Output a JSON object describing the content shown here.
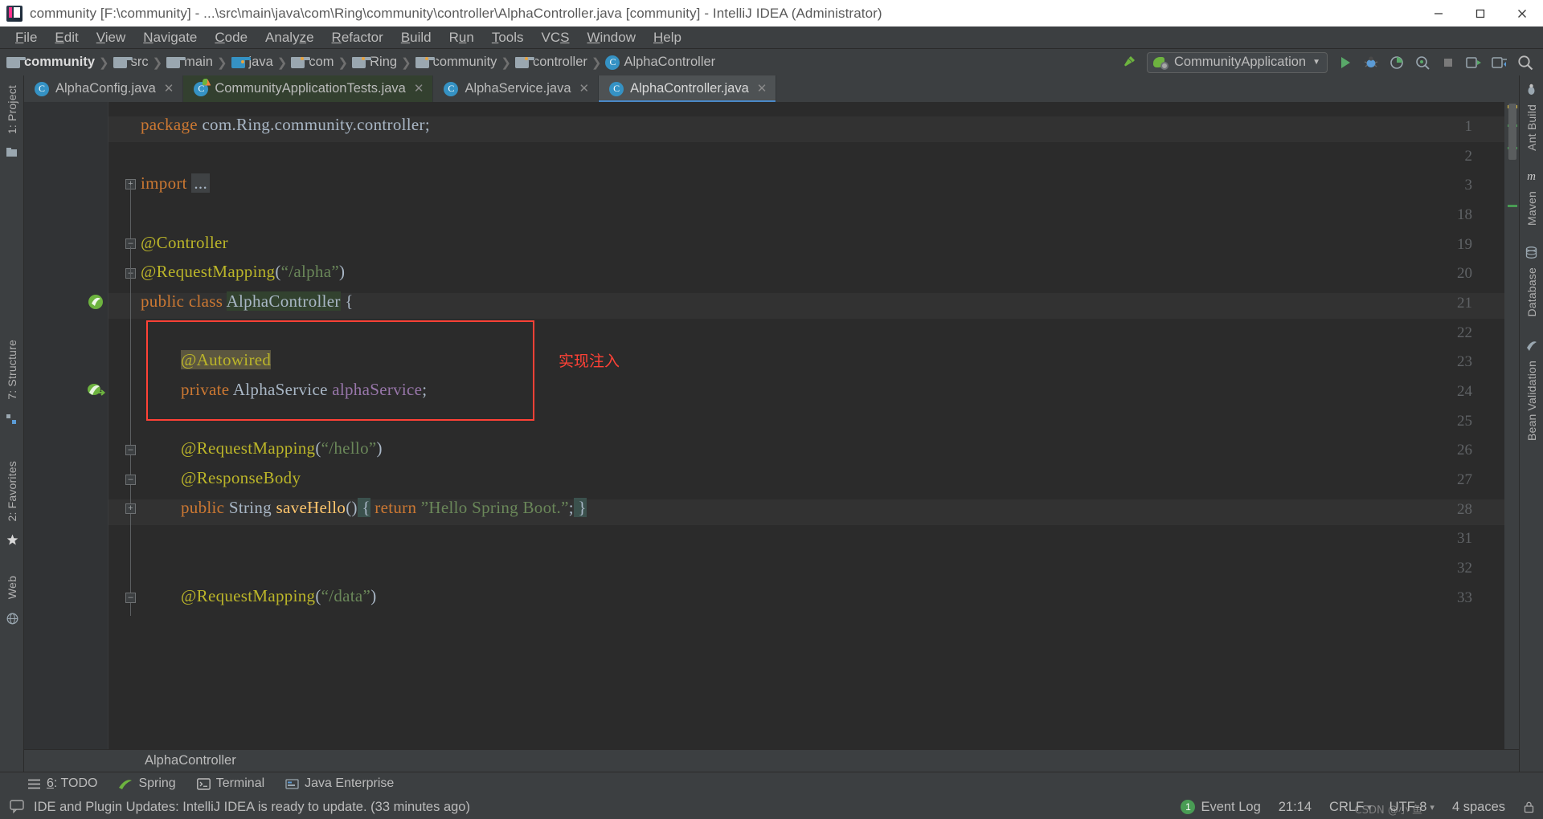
{
  "window": {
    "title": "community [F:\\community] - ...\\src\\main\\java\\com\\Ring\\community\\controller\\AlphaController.java [community] - IntelliJ IDEA (Administrator)",
    "app_icon": "intellij-idea-icon",
    "controls": {
      "minimize": "minimize-icon",
      "maximize": "maximize-icon",
      "close": "close-icon"
    }
  },
  "menu": [
    {
      "label": "File",
      "mnemonic": "F"
    },
    {
      "label": "Edit",
      "mnemonic": "E"
    },
    {
      "label": "View",
      "mnemonic": "V"
    },
    {
      "label": "Navigate",
      "mnemonic": "N"
    },
    {
      "label": "Code",
      "mnemonic": "C"
    },
    {
      "label": "Analyze",
      "mnemonic": "z"
    },
    {
      "label": "Refactor",
      "mnemonic": "R"
    },
    {
      "label": "Build",
      "mnemonic": "B"
    },
    {
      "label": "Run",
      "mnemonic": "u"
    },
    {
      "label": "Tools",
      "mnemonic": "T"
    },
    {
      "label": "VCS",
      "mnemonic": "S"
    },
    {
      "label": "Window",
      "mnemonic": "W"
    },
    {
      "label": "Help",
      "mnemonic": "H"
    }
  ],
  "breadcrumb": [
    {
      "label": "community",
      "icon": "folder-icon",
      "kind": "module",
      "bold": true
    },
    {
      "label": "src",
      "icon": "folder-icon",
      "kind": "folder"
    },
    {
      "label": "main",
      "icon": "folder-icon",
      "kind": "folder"
    },
    {
      "label": "java",
      "icon": "source-root-folder-icon",
      "kind": "source-root"
    },
    {
      "label": "com",
      "icon": "package-folder-icon",
      "kind": "package"
    },
    {
      "label": "Ring",
      "icon": "package-folder-icon",
      "kind": "package"
    },
    {
      "label": "community",
      "icon": "package-folder-icon",
      "kind": "package"
    },
    {
      "label": "controller",
      "icon": "package-folder-icon",
      "kind": "package"
    },
    {
      "label": "AlphaController",
      "icon": "java-class-icon",
      "kind": "class"
    }
  ],
  "toolbar": {
    "build_icon": "hammer-build-icon",
    "run_config": {
      "name": "CommunityApplication",
      "icon": "spring-boot-icon",
      "caret": "chevron-down-icon"
    },
    "buttons": [
      {
        "name": "run-button",
        "icon": "play-icon",
        "color": "#59a869"
      },
      {
        "name": "debug-button",
        "icon": "debug-bug-icon",
        "color": "#9aa7b0"
      },
      {
        "name": "run-with-coverage-button",
        "icon": "coverage-icon",
        "color": "#9aa7b0"
      },
      {
        "name": "profile-button",
        "icon": "profiler-icon",
        "color": "#9aa7b0"
      },
      {
        "name": "stop-button",
        "icon": "stop-square-icon",
        "color": "#8a8a8a"
      },
      {
        "name": "git-update-button",
        "icon": "update-project-icon",
        "color": "#9aa7b0"
      },
      {
        "name": "git-commit-button",
        "icon": "commit-icon",
        "color": "#9aa7b0"
      },
      {
        "name": "search-everywhere-button",
        "icon": "search-icon",
        "color": "#bbbbbb"
      }
    ]
  },
  "tabs": [
    {
      "label": "AlphaConfig.java",
      "icon": "java-class-icon",
      "active": false,
      "modified": false,
      "close": "close-icon"
    },
    {
      "label": "CommunityApplicationTests.java",
      "icon": "spring-boot-class-icon",
      "active": false,
      "modified": true,
      "close": "close-icon"
    },
    {
      "label": "AlphaService.java",
      "icon": "java-class-icon",
      "active": false,
      "modified": false,
      "close": "close-icon"
    },
    {
      "label": "AlphaController.java",
      "icon": "java-class-icon",
      "active": true,
      "modified": false,
      "close": "close-icon"
    }
  ],
  "editor": {
    "language": "java",
    "line_numbers": [
      1,
      2,
      3,
      18,
      19,
      20,
      21,
      22,
      23,
      24,
      25,
      26,
      27,
      28,
      31,
      32,
      33
    ],
    "gutter_icons": [
      {
        "line": 21,
        "name": "spring-bean-gutter-icon"
      },
      {
        "line": 24,
        "name": "spring-autowired-gutter-icon"
      }
    ],
    "fold_markers": [
      {
        "line": 3,
        "glyph": "+",
        "name": "expand-imports-fold-icon"
      },
      {
        "line": 19,
        "glyph": "-",
        "name": "collapse-class-fold-icon"
      },
      {
        "line": 20,
        "glyph": "-",
        "name": "collapse-fold-icon"
      },
      {
        "line": 26,
        "glyph": "-",
        "name": "collapse-method-fold-icon"
      },
      {
        "line": 27,
        "glyph": "-",
        "name": "collapse-fold-icon"
      },
      {
        "line": 28,
        "glyph": "+",
        "name": "expand-body-fold-icon"
      },
      {
        "line": 33,
        "glyph": "-",
        "name": "collapse-method-fold-icon"
      }
    ],
    "lines": [
      {
        "n": 1,
        "tokens": [
          {
            "t": "package",
            "c": "kw"
          },
          {
            "t": " com.Ring.community.controller;",
            "c": "plain"
          }
        ]
      },
      {
        "n": 2,
        "tokens": []
      },
      {
        "n": 3,
        "tokens": [
          {
            "t": "import",
            "c": "kw"
          },
          {
            "t": " ",
            "c": "plain"
          },
          {
            "t": "...",
            "c": "plain",
            "hl": "folded"
          }
        ]
      },
      {
        "n": 18,
        "tokens": []
      },
      {
        "n": 19,
        "tokens": [
          {
            "t": "@Controller",
            "c": "ann"
          }
        ]
      },
      {
        "n": 20,
        "tokens": [
          {
            "t": "@RequestMapping",
            "c": "ann"
          },
          {
            "t": "(",
            "c": "plain"
          },
          {
            "t": "\"/alpha\"",
            "c": "str"
          },
          {
            "t": ")",
            "c": "plain"
          }
        ]
      },
      {
        "n": 21,
        "tokens": [
          {
            "t": "public class ",
            "c": "kw"
          },
          {
            "t": "AlphaController",
            "c": "cls",
            "hl": "class"
          },
          {
            "t": " {",
            "c": "plain"
          }
        ]
      },
      {
        "n": 22,
        "tokens": []
      },
      {
        "n": 23,
        "tokens": [
          {
            "t": "@Autowired",
            "c": "ann",
            "hl": "ann"
          }
        ]
      },
      {
        "n": 24,
        "tokens": [
          {
            "t": "private ",
            "c": "kw"
          },
          {
            "t": "AlphaService ",
            "c": "cls"
          },
          {
            "t": "alphaService",
            "c": "fld"
          },
          {
            "t": ";",
            "c": "plain"
          }
        ]
      },
      {
        "n": 25,
        "tokens": []
      },
      {
        "n": 26,
        "tokens": [
          {
            "t": "@RequestMapping",
            "c": "ann"
          },
          {
            "t": "(",
            "c": "plain"
          },
          {
            "t": "\"/hello\"",
            "c": "str"
          },
          {
            "t": ")",
            "c": "plain"
          }
        ]
      },
      {
        "n": 27,
        "tokens": [
          {
            "t": "@ResponseBody",
            "c": "ann"
          }
        ]
      },
      {
        "n": 28,
        "tokens": [
          {
            "t": "public ",
            "c": "kw"
          },
          {
            "t": "String ",
            "c": "cls"
          },
          {
            "t": "saveHello",
            "c": "mth"
          },
          {
            "t": "()",
            "c": "plain"
          },
          {
            "t": " {",
            "c": "plain",
            "hl": "brace"
          },
          {
            "t": " return ",
            "c": "kw"
          },
          {
            "t": "\"Hello Spring Boot.\"",
            "c": "str"
          },
          {
            "t": ";",
            "c": "plain"
          },
          {
            "t": " }",
            "c": "plain",
            "hl": "brace"
          }
        ]
      },
      {
        "n": 31,
        "tokens": []
      },
      {
        "n": 32,
        "tokens": []
      },
      {
        "n": 33,
        "tokens": [
          {
            "t": "@RequestMapping",
            "c": "ann"
          },
          {
            "t": "(",
            "c": "plain"
          },
          {
            "t": "\"/data\"",
            "c": "str"
          },
          {
            "t": ")",
            "c": "plain"
          }
        ]
      }
    ],
    "annotation": {
      "note_text": "实现注入",
      "box_color": "#ff4136"
    },
    "footer_breadcrumb": "AlphaController"
  },
  "left_toolwindows": [
    {
      "label": "1: Project",
      "icon": "project-tree-icon"
    },
    {
      "label": "7: Structure",
      "icon": "structure-icon"
    },
    {
      "label": "2: Favorites",
      "icon": "favorites-star-icon"
    },
    {
      "label": "Web",
      "icon": "web-globe-icon"
    }
  ],
  "right_toolwindows": [
    {
      "label": "Ant Build",
      "icon": "ant-icon"
    },
    {
      "label": "Maven",
      "icon": "maven-m-icon"
    },
    {
      "label": "Database",
      "icon": "database-icon"
    },
    {
      "label": "Bean Validation",
      "icon": "bean-validation-icon"
    }
  ],
  "bottom_toolwindows": [
    {
      "label": "6: TODO",
      "mnemonic": "6",
      "icon": "todo-list-icon"
    },
    {
      "label": "Spring",
      "icon": "spring-leaf-icon"
    },
    {
      "label": "Terminal",
      "icon": "terminal-icon"
    },
    {
      "label": "Java Enterprise",
      "icon": "java-enterprise-icon"
    }
  ],
  "statusbar": {
    "icon": "notification-balloon-icon",
    "message": "IDE and Plugin Updates: IntelliJ IDEA is ready to update. (33 minutes ago)",
    "time": "21:14",
    "line_separator": "CRLF",
    "encoding": "UTF-8",
    "indent": "4 spaces",
    "event_log_count": "1",
    "event_log_label": "Event Log",
    "watermark": "CSDN @小 鱼"
  },
  "colors": {
    "ide_bg": "#3c3f41",
    "editor_bg": "#2b2b2b",
    "gutter_bg": "#313335",
    "accent_blue": "#4a88c7",
    "annotation_yellow": "#bbb529",
    "keyword_orange": "#cc7832",
    "string_green": "#6a8759",
    "field_purple": "#9876aa",
    "method_yellow": "#ffc66d",
    "text_gray": "#a9b7c6",
    "red_box": "#ff4136",
    "spring_green": "#6db33f"
  }
}
